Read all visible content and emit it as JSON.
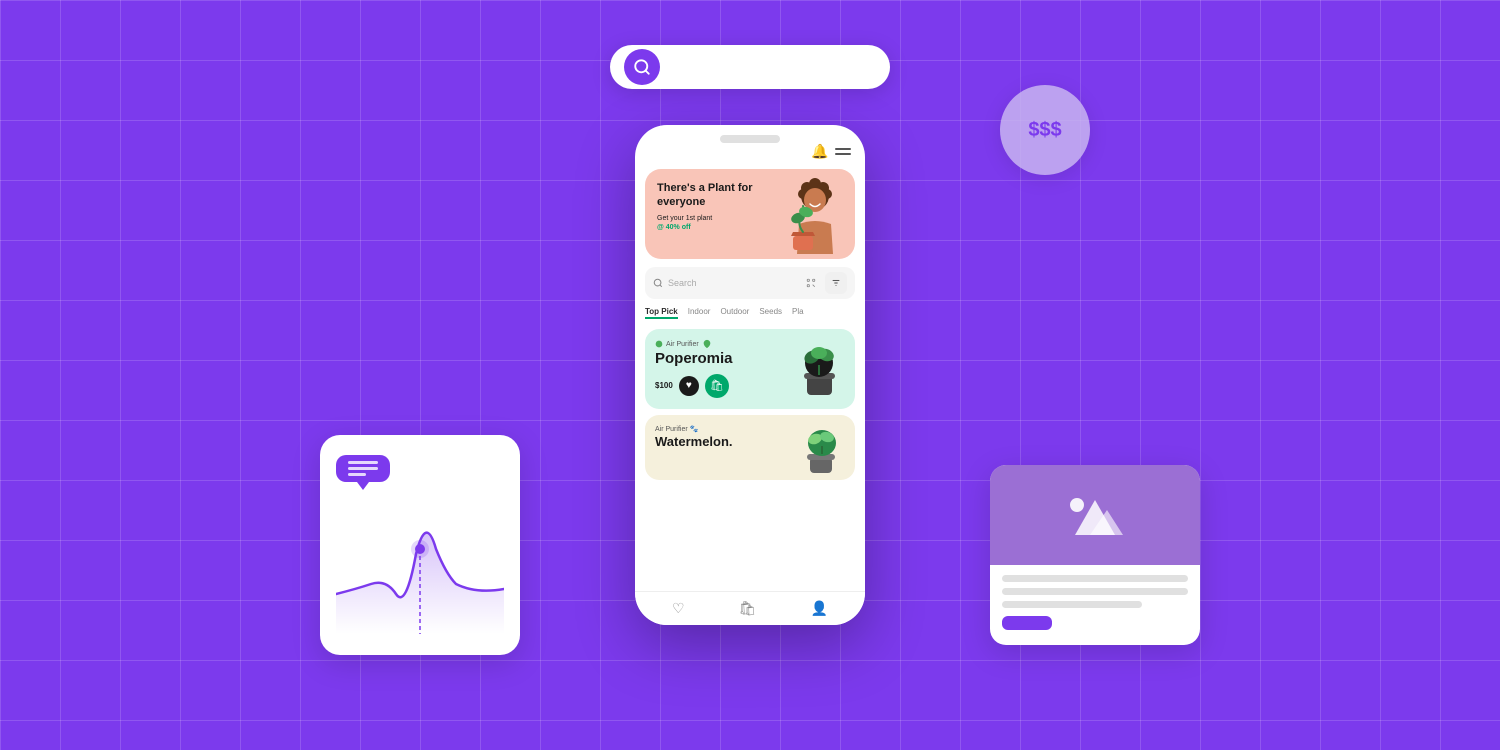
{
  "background": {
    "color": "#7c3aed",
    "grid_color": "rgba(255,255,255,0.15)"
  },
  "floating_search": {
    "placeholder": "",
    "icon": "search"
  },
  "money_badge": {
    "text": "$$$",
    "color": "#7c3aed"
  },
  "phone": {
    "banner": {
      "title": "There's a Plant for everyone",
      "subtitle": "Get your 1st plant",
      "highlight": "@ 40% off"
    },
    "search": {
      "placeholder": "Search",
      "icons": [
        "search",
        "scan",
        "filter"
      ]
    },
    "categories": [
      {
        "label": "Top Pick",
        "active": true
      },
      {
        "label": "Indoor",
        "active": false
      },
      {
        "label": "Outdoor",
        "active": false
      },
      {
        "label": "Seeds",
        "active": false
      },
      {
        "label": "Pla...",
        "active": false
      }
    ],
    "products": [
      {
        "tag": "Air Purifier",
        "name": "Poperomia",
        "price": "100",
        "bg_color": "#d4f5e9"
      },
      {
        "tag": "Air Purifier",
        "name": "Watermelon...",
        "price": "",
        "bg_color": "#f5f0dc"
      }
    ],
    "nav": [
      "heart",
      "bag",
      "person"
    ]
  },
  "chart_card": {
    "bubble_lines": 3
  },
  "content_card": {
    "image_placeholder": "mountain",
    "has_button": true,
    "button_color": "#7c3aed"
  }
}
